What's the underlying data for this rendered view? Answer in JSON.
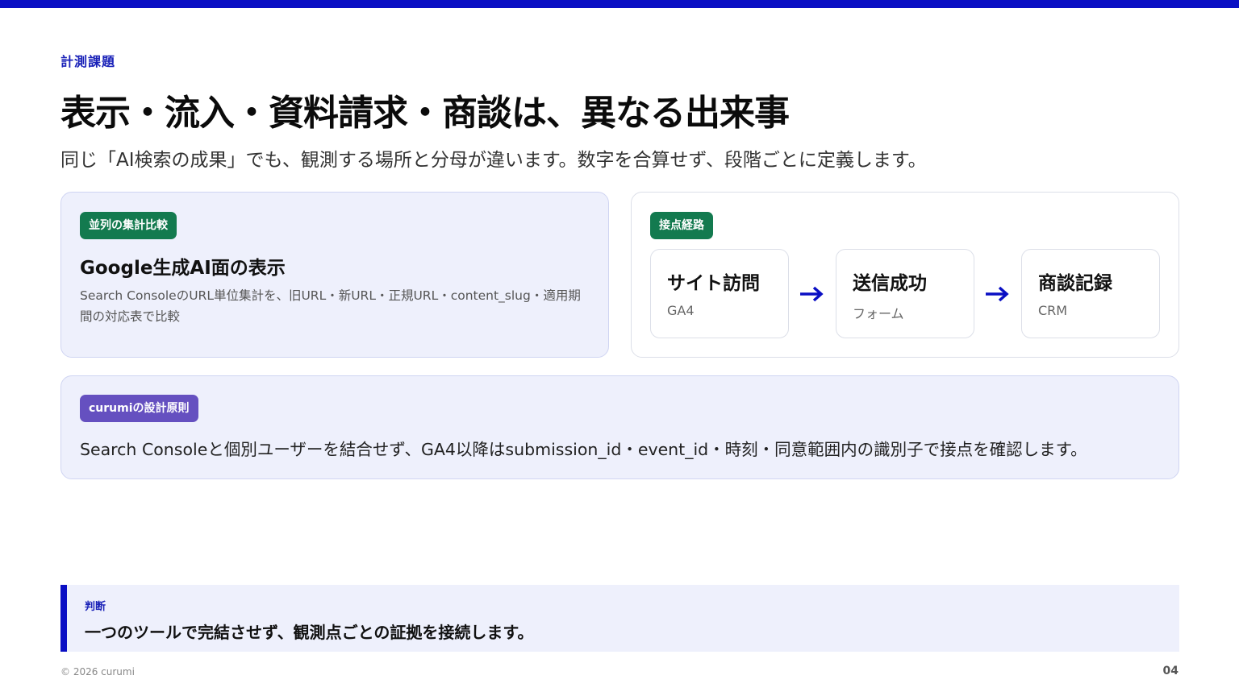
{
  "accent": "#0a0fc4",
  "eyebrow": "計測課題",
  "title": "表示・流入・資料請求・商談は、異なる出来事",
  "subtitle": "同じ「AI検索の成果」でも、観測する場所と分母が違います。数字を合算せず、段階ごとに定義します。",
  "left_card": {
    "badge": "並列の集計比較",
    "title": "Google生成AI面の表示",
    "description": "Search ConsoleのURL単位集計を、旧URL・新URL・正規URL・content_slug・適用期間の対応表で比較"
  },
  "right_card": {
    "badge": "接点経路",
    "steps": [
      {
        "title": "サイト訪問",
        "sub": "GA4"
      },
      {
        "title": "送信成功",
        "sub": "フォーム"
      },
      {
        "title": "商談記録",
        "sub": "CRM"
      }
    ],
    "arrow_icon": "arrow-right-icon"
  },
  "principle_card": {
    "badge": "curumiの設計原則",
    "text": "Search Consoleと個別ユーザーを結合せず、GA4以降はsubmission_id・event_id・時刻・同意範囲内の識別子で接点を確認します。"
  },
  "verdict": {
    "label": "判断",
    "text": "一つのツールで完結させず、観測点ごとの証拠を接続します。"
  },
  "footer": {
    "copyright": "© 2026 curumi",
    "page_number": "04"
  }
}
